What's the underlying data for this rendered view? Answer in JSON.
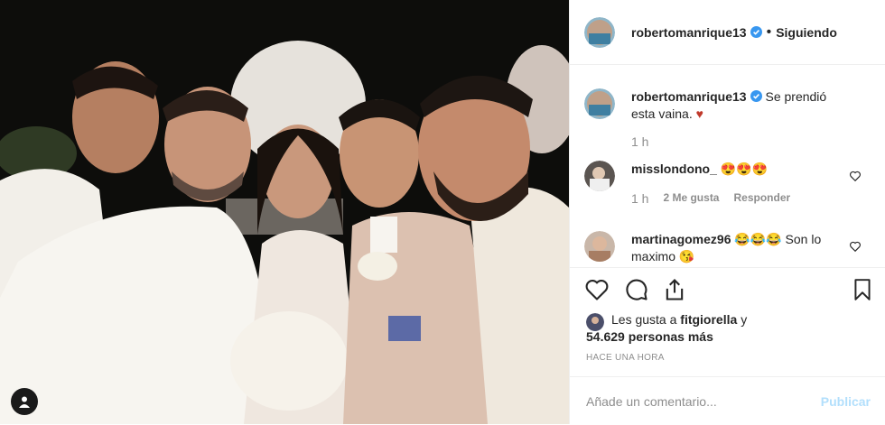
{
  "post": {
    "author": "robertomanrique13",
    "follow_status": "Siguiendo",
    "separator": "•",
    "caption_user": "robertomanrique13",
    "caption_text": "Se prendió esta vaina.",
    "caption_emoji": "♥",
    "caption_time": "1 h",
    "likes_prefix": "Les gusta a",
    "likes_user": "fitgiorella",
    "likes_suffix": "y",
    "likes_count": "54.629 personas más",
    "time_ago": "HACE UNA HORA"
  },
  "comments": [
    {
      "user": "misslondono_",
      "text": "😍😍😍",
      "time": "1 h",
      "likes": "2 Me gusta",
      "reply": "Responder"
    },
    {
      "user": "martinagomez96",
      "text": "😂😂😂 Son lo maximo 😘"
    }
  ],
  "add_comment": {
    "placeholder": "Añade un comentario...",
    "submit": "Publicar"
  },
  "icons": [
    "verified-icon",
    "heart-icon",
    "comment-icon",
    "share-icon",
    "bookmark-icon",
    "user-tag-icon"
  ],
  "colors": {
    "verified": "#3897f0",
    "heart": "#c0392b",
    "publish_disabled": "#b2dffc",
    "muted": "#8e8e8e"
  }
}
